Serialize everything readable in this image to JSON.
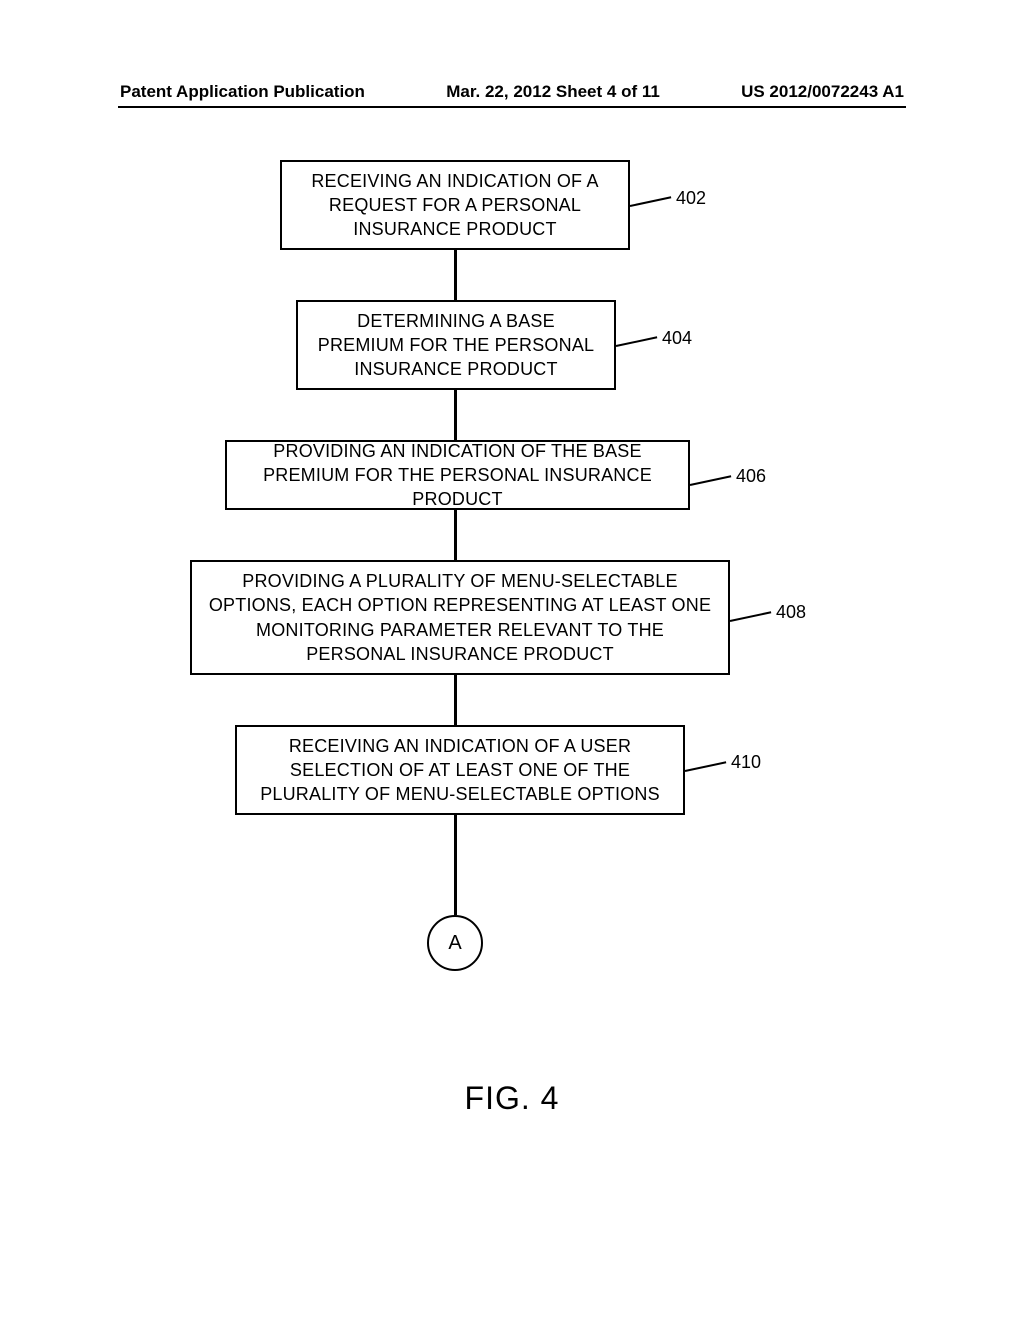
{
  "header": {
    "left": "Patent Application Publication",
    "center": "Mar. 22, 2012  Sheet 4 of 11",
    "right": "US 2012/0072243 A1"
  },
  "boxes": {
    "b1": {
      "text": "RECEIVING AN INDICATION OF A REQUEST FOR A PERSONAL INSURANCE PRODUCT",
      "ref": "402"
    },
    "b2": {
      "text": "DETERMINING A BASE PREMIUM FOR THE PERSONAL INSURANCE PRODUCT",
      "ref": "404"
    },
    "b3": {
      "text": "PROVIDING AN INDICATION OF THE BASE PREMIUM FOR THE PERSONAL INSURANCE PRODUCT",
      "ref": "406"
    },
    "b4": {
      "text": "PROVIDING A PLURALITY OF MENU-SELECTABLE OPTIONS, EACH OPTION REPRESENTING AT LEAST ONE MONITORING PARAMETER RELEVANT TO THE PERSONAL INSURANCE PRODUCT",
      "ref": "408"
    },
    "b5": {
      "text": "RECEIVING AN INDICATION OF A USER SELECTION OF AT LEAST ONE OF THE PLURALITY OF MENU-SELECTABLE OPTIONS",
      "ref": "410"
    }
  },
  "connector": {
    "label": "A"
  },
  "figure_caption": "FIG. 4"
}
